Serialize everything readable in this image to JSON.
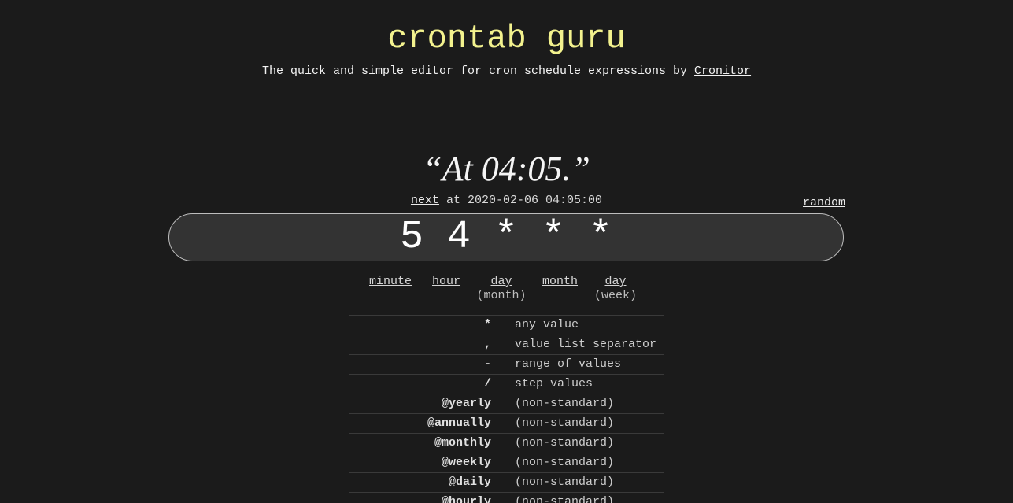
{
  "header": {
    "title": "crontab guru",
    "subtitle": "The quick and simple editor for cron schedule expressions by",
    "subtitle_link": "Cronitor"
  },
  "human_readable": "“At 04:05.”",
  "next": {
    "link": "next",
    "text": "at 2020-02-06 04:05:00"
  },
  "random_link": "random",
  "expression": "5 4 * * *",
  "fields": [
    {
      "label": "minute",
      "sub": ""
    },
    {
      "label": "hour",
      "sub": ""
    },
    {
      "label": "day",
      "sub": "(month)"
    },
    {
      "label": "month",
      "sub": ""
    },
    {
      "label": "day",
      "sub": "(week)"
    }
  ],
  "legend": [
    {
      "symbol": "*",
      "desc": "any value"
    },
    {
      "symbol": ",",
      "desc": "value list separator"
    },
    {
      "symbol": "-",
      "desc": "range of values"
    },
    {
      "symbol": "/",
      "desc": "step values"
    },
    {
      "symbol": "@yearly",
      "desc": "(non-standard)"
    },
    {
      "symbol": "@annually",
      "desc": "(non-standard)"
    },
    {
      "symbol": "@monthly",
      "desc": "(non-standard)"
    },
    {
      "symbol": "@weekly",
      "desc": "(non-standard)"
    },
    {
      "symbol": "@daily",
      "desc": "(non-standard)"
    },
    {
      "symbol": "@hourly",
      "desc": "(non-standard)"
    }
  ],
  "colors": {
    "background": "#1b1b1b",
    "title": "#f3f28e",
    "input_bg": "#333333"
  }
}
